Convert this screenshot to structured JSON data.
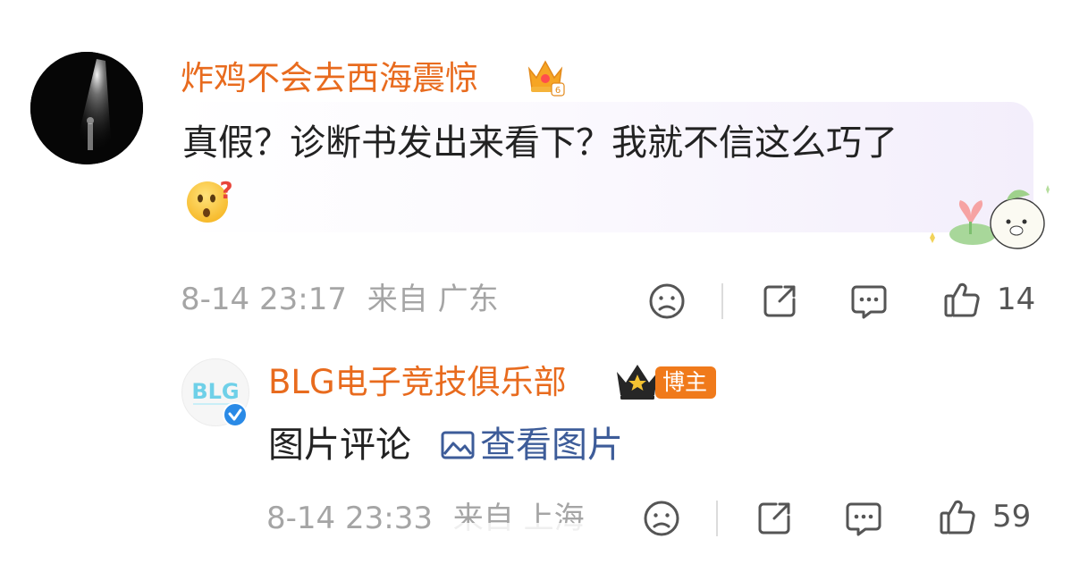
{
  "comments": [
    {
      "username": "炸鸡不会去西海震惊",
      "text": "真假？诊断书发出来看下？我就不信这么巧了",
      "emoji": "question-face-emoji",
      "time": "8-14 23:17",
      "location": "来自 广东",
      "likes": "14"
    },
    {
      "username": "BLG电子竞技俱乐部",
      "badge": "博主",
      "avatar_text": "BLG",
      "text": "图片评论",
      "link_text": "查看图片",
      "time": "8-14 23:33",
      "location": "来自 上海",
      "likes": "59"
    }
  ],
  "icons": [
    "sad-face-icon",
    "share-icon",
    "comment-icon",
    "thumbs-up-icon",
    "crown-icon",
    "verified-icon",
    "image-icon"
  ],
  "colors": {
    "username": "#e86b1e",
    "link": "#3d5c99",
    "meta": "#a5a5a5",
    "badge": "#f07a1b",
    "verified": "#2a8ae6"
  }
}
